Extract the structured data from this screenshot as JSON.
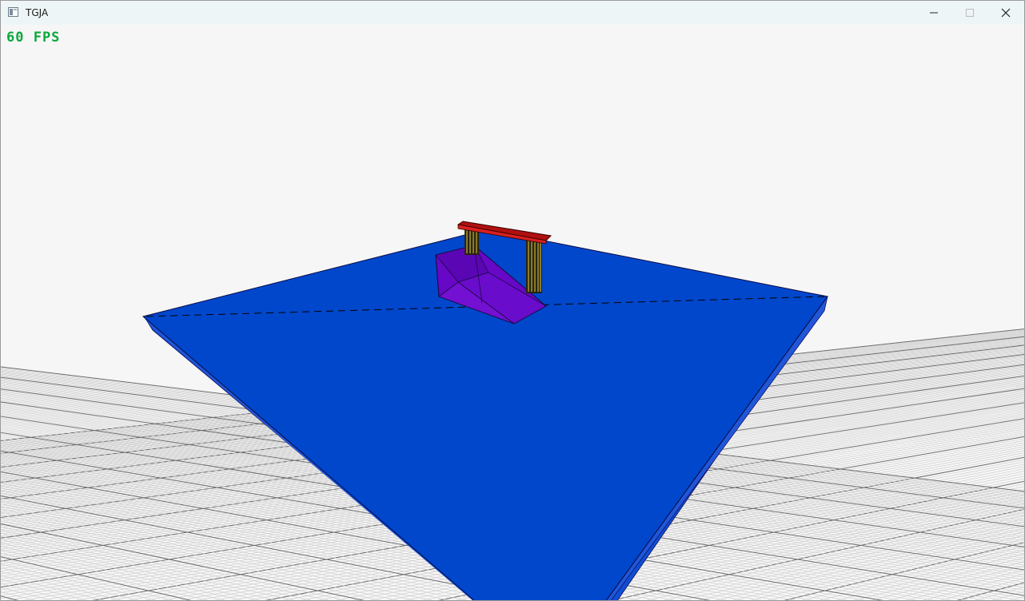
{
  "window": {
    "title": "TGJA",
    "app_icon": "app-window-icon",
    "controls": {
      "minimize": "—",
      "maximize": "☐",
      "close": "✕"
    }
  },
  "hud": {
    "fps_text": "60 FPS",
    "fps_color": "#0ba83a"
  },
  "scene": {
    "background_color": "#f6f6f6",
    "grid_color": "#c8c8c8",
    "floor_color": "#0047cc",
    "ramp_color": "#6a0cc8",
    "rail_color": "#d01818",
    "post_color": "#e8d040"
  }
}
